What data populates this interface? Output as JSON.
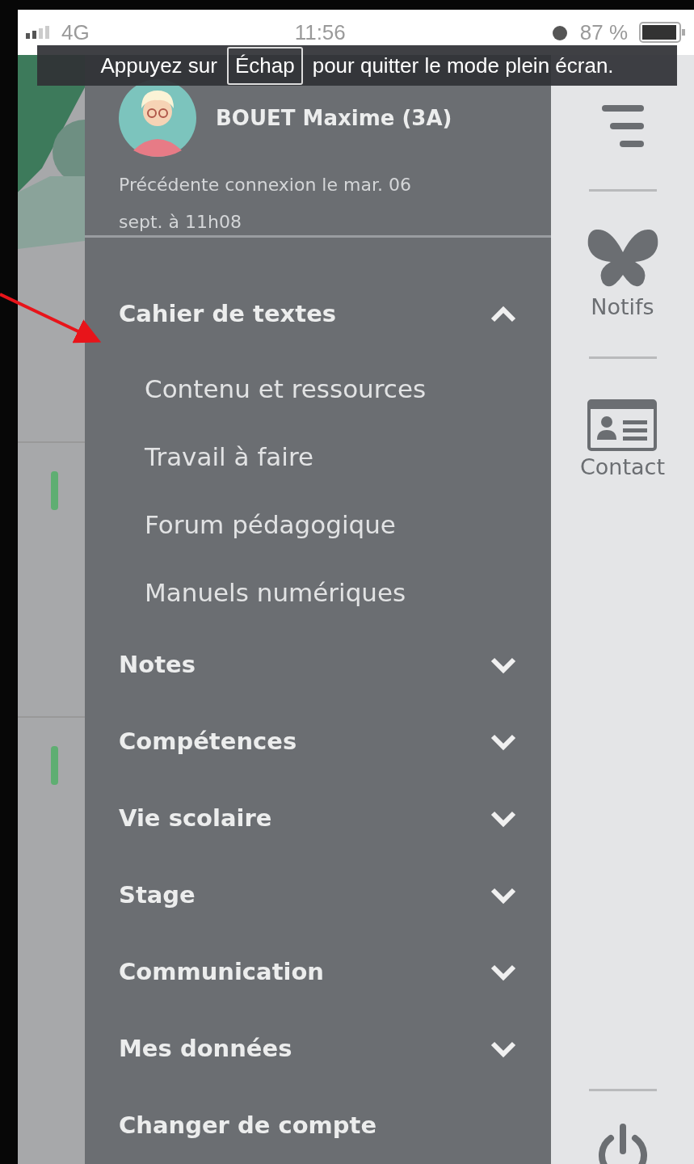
{
  "status_bar": {
    "network": "4G",
    "time": "11:56",
    "battery": "87 %"
  },
  "fullscreen_notice": {
    "before": "Appuyez sur",
    "key": "Échap",
    "after": "pour quitter le mode plein écran."
  },
  "user": {
    "name": "BOUET Maxime (3A)",
    "last_login": "Précédente connexion le mar. 06 sept. à 11h08"
  },
  "menu": [
    {
      "label": "Cahier de textes",
      "expanded": true,
      "children": [
        {
          "label": "Contenu et ressources"
        },
        {
          "label": "Travail à faire"
        },
        {
          "label": "Forum pédagogique"
        },
        {
          "label": "Manuels numériques"
        }
      ]
    },
    {
      "label": "Notes",
      "expanded": false
    },
    {
      "label": "Compétences",
      "expanded": false
    },
    {
      "label": "Vie scolaire",
      "expanded": false
    },
    {
      "label": "Stage",
      "expanded": false
    },
    {
      "label": "Communication",
      "expanded": false
    },
    {
      "label": "Mes données",
      "expanded": false
    },
    {
      "label": "Changer de compte",
      "kind": "plain"
    }
  ],
  "rail": [
    {
      "kind": "notifs",
      "label": "Notifs"
    },
    {
      "kind": "contact",
      "label": "Contact"
    }
  ]
}
